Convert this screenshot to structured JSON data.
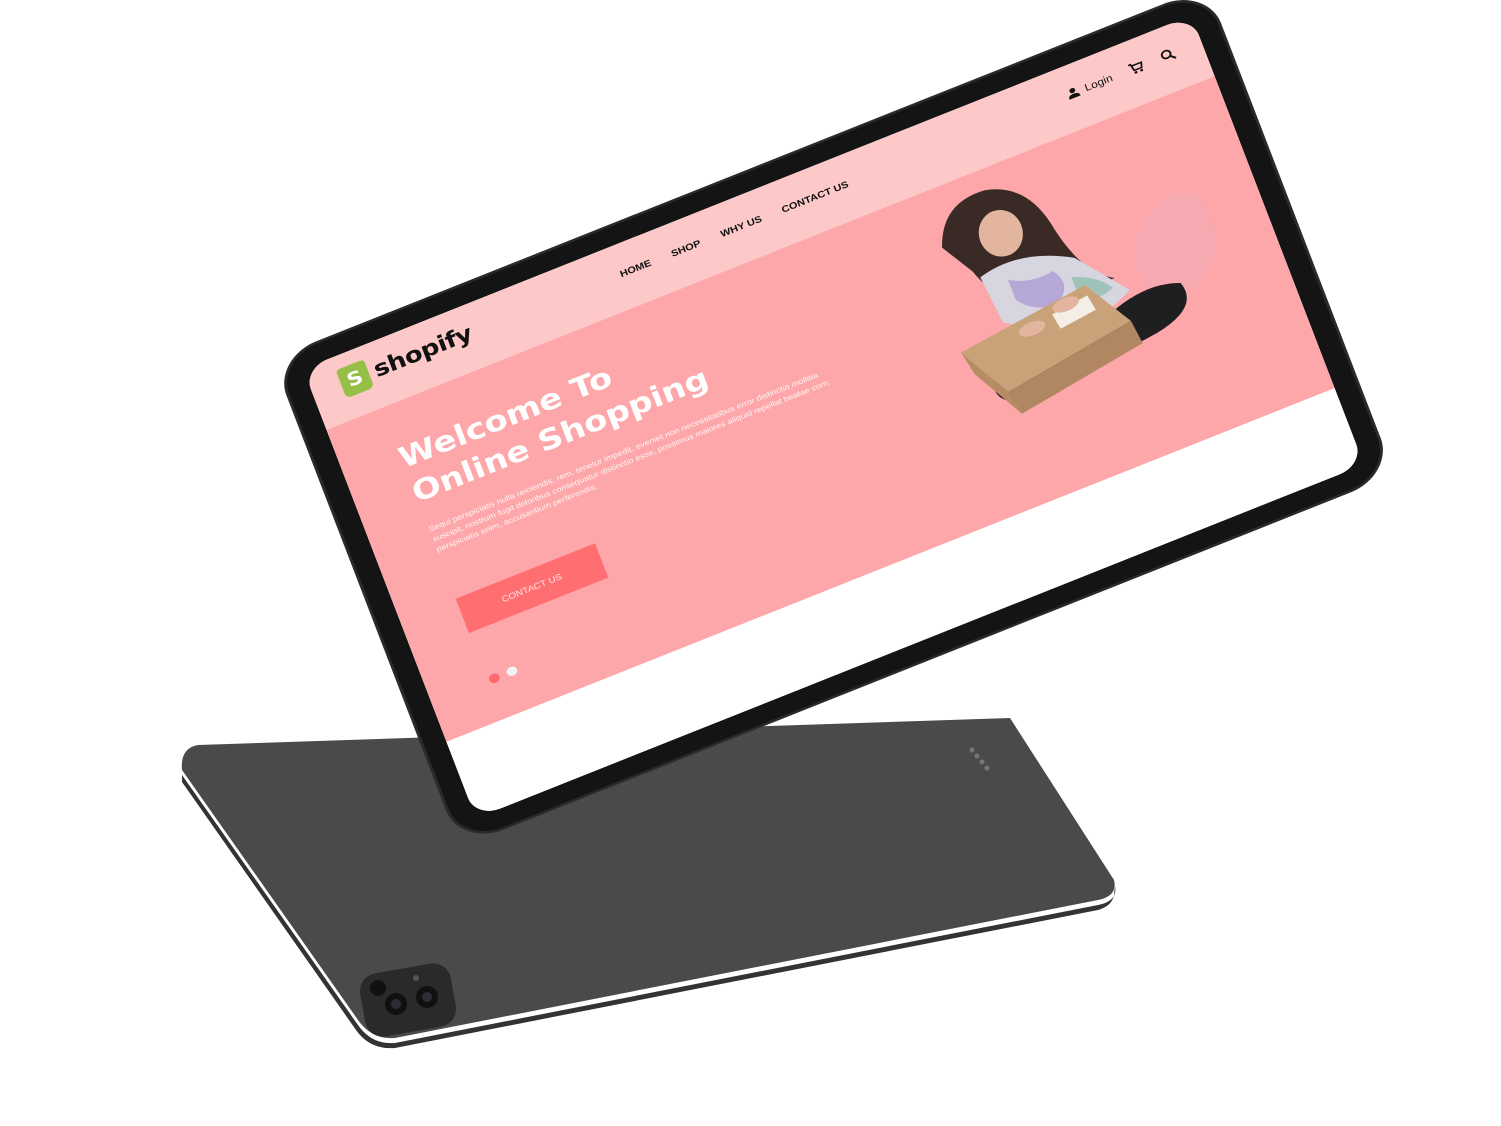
{
  "brand": {
    "logo_letter": "S",
    "name": "shopify",
    "color": "#95bf47"
  },
  "nav": {
    "items": [
      "HOME",
      "SHOP",
      "WHY US",
      "CONTACT US"
    ]
  },
  "header_actions": {
    "login_label": "Login",
    "user_icon": "user-icon",
    "cart_icon": "cart-icon",
    "search_icon": "search-icon"
  },
  "hero": {
    "title_line1": "Welcome To",
    "title_line2": "Online Shopping",
    "body": "Sequi perspiciatis nulla reiciendis, rem, tenetur impedit, eveniet non necessitatibus error distinctio mollitia suscipit, nostrum fugit doloribus consequatur distinctio esse, possimus maiores aliquid repellat beatae cum, perspiciatis enim, accusantium perferendis.",
    "cta_label": "CONTACT US",
    "slides_total": 2,
    "active_slide": 1
  },
  "colors": {
    "header_bg": "#fdc8c8",
    "hero_bg": "#fda7aa",
    "cta_bg": "#ff6f72",
    "device_body": "#4a4a4a",
    "device_bezel": "#141414"
  }
}
